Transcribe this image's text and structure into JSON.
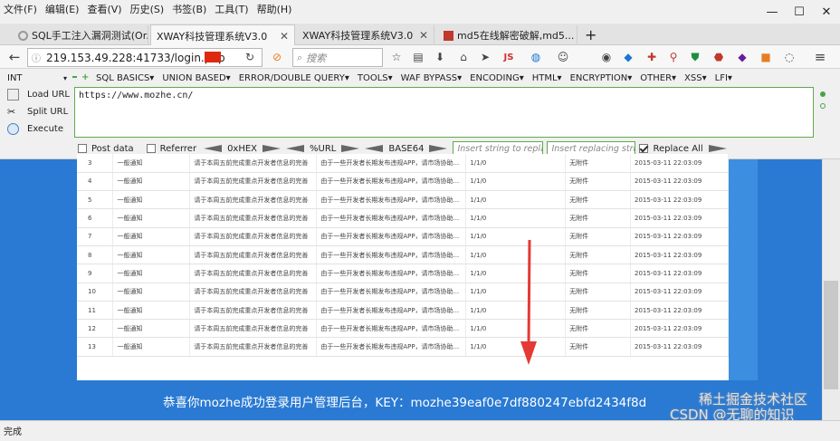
{
  "menubar": [
    "文件(F)",
    "编辑(E)",
    "查看(V)",
    "历史(S)",
    "书签(B)",
    "工具(T)",
    "帮助(H)"
  ],
  "tabs": [
    {
      "title": "SQL手工注入漏洞测试(Or...",
      "active": false
    },
    {
      "title": "XWAY科技管理系统V3.0",
      "active": true
    },
    {
      "title": "XWAY科技管理系统V3.0",
      "active": false
    },
    {
      "title": "md5在线解密破解,md5...",
      "active": false
    }
  ],
  "navbar": {
    "url": "219.153.49.228:41733/login.php",
    "search_placeholder": "搜索"
  },
  "hackbar": {
    "select_value": "INT",
    "menus": [
      "SQL BASICS▾",
      "UNION BASED▾",
      "ERROR/DOUBLE QUERY▾",
      "TOOLS▾",
      "WAF BYPASS▾",
      "ENCODING▾",
      "HTML▾",
      "ENCRYPTION▾",
      "OTHER▾",
      "XSS▾",
      "LFI▾"
    ],
    "load_url": "Load URL",
    "split_url": "Split URL",
    "execute": "Execute",
    "url_value": "https://www.mozhe.cn/",
    "post_data": "Post data",
    "referrer": "Referrer",
    "hex": "0xHEX",
    "url_enc": "%URL",
    "base64": "BASE64",
    "insert_string": "Insert string to replace",
    "insert_replacing": "Insert replacing string",
    "replace_all": "Replace All"
  },
  "table": {
    "rows": [
      {
        "id": "3",
        "type": "一般通知",
        "title": "请于本周五前完成重点开发者信息的完善",
        "content": "由于一些开发者长期发布违规APP，请市场协助...",
        "ver": "1/1/0",
        "attach": "无附件",
        "date": "2015-03-11 22:03:09"
      },
      {
        "id": "4",
        "type": "一般通知",
        "title": "请于本周五前完成重点开发者信息的完善",
        "content": "由于一些开发者长期发布违规APP，请市场协助...",
        "ver": "1/1/0",
        "attach": "无附件",
        "date": "2015-03-11 22:03:09"
      },
      {
        "id": "5",
        "type": "一般通知",
        "title": "请于本周五前完成重点开发者信息的完善",
        "content": "由于一些开发者长期发布违规APP，请市场协助...",
        "ver": "1/1/0",
        "attach": "无附件",
        "date": "2015-03-11 22:03:09"
      },
      {
        "id": "6",
        "type": "一般通知",
        "title": "请于本周五前完成重点开发者信息的完善",
        "content": "由于一些开发者长期发布违规APP，请市场协助...",
        "ver": "1/1/0",
        "attach": "无附件",
        "date": "2015-03-11 22:03:09"
      },
      {
        "id": "7",
        "type": "一般通知",
        "title": "请于本周五前完成重点开发者信息的完善",
        "content": "由于一些开发者长期发布违规APP，请市场协助...",
        "ver": "1/1/0",
        "attach": "无附件",
        "date": "2015-03-11 22:03:09"
      },
      {
        "id": "8",
        "type": "一般通知",
        "title": "请于本周五前完成重点开发者信息的完善",
        "content": "由于一些开发者长期发布违规APP，请市场协助...",
        "ver": "1/1/0",
        "attach": "无附件",
        "date": "2015-03-11 22:03:09"
      },
      {
        "id": "9",
        "type": "一般通知",
        "title": "请于本周五前完成重点开发者信息的完善",
        "content": "由于一些开发者长期发布违规APP，请市场协助...",
        "ver": "1/1/0",
        "attach": "无附件",
        "date": "2015-03-11 22:03:09"
      },
      {
        "id": "10",
        "type": "一般通知",
        "title": "请于本周五前完成重点开发者信息的完善",
        "content": "由于一些开发者长期发布违规APP，请市场协助...",
        "ver": "1/1/0",
        "attach": "无附件",
        "date": "2015-03-11 22:03:09"
      },
      {
        "id": "11",
        "type": "一般通知",
        "title": "请于本周五前完成重点开发者信息的完善",
        "content": "由于一些开发者长期发布违规APP，请市场协助...",
        "ver": "1/1/0",
        "attach": "无附件",
        "date": "2015-03-11 22:03:09"
      },
      {
        "id": "12",
        "type": "一般通知",
        "title": "请于本周五前完成重点开发者信息的完善",
        "content": "由于一些开发者长期发布违规APP，请市场协助...",
        "ver": "1/1/0",
        "attach": "无附件",
        "date": "2015-03-11 22:03:09"
      },
      {
        "id": "13",
        "type": "一般通知",
        "title": "请于本周五前完成重点开发者信息的完善",
        "content": "由于一些开发者长期发布违规APP，请市场协助...",
        "ver": "1/1/0",
        "attach": "无附件",
        "date": "2015-03-11 22:03:09"
      }
    ]
  },
  "key_message": "恭喜你mozhe成功登录用户管理后台，KEY：mozhe39eaf0e7df880247ebfd2434f8d",
  "status": "完成",
  "watermark": "CSDN @无聊的知识",
  "watermark2": "稀土掘金技术社区",
  "colors": {
    "page_bg": "#2a7ad3",
    "arrow": "#e53935",
    "hackbar_border": "#61a84f"
  }
}
